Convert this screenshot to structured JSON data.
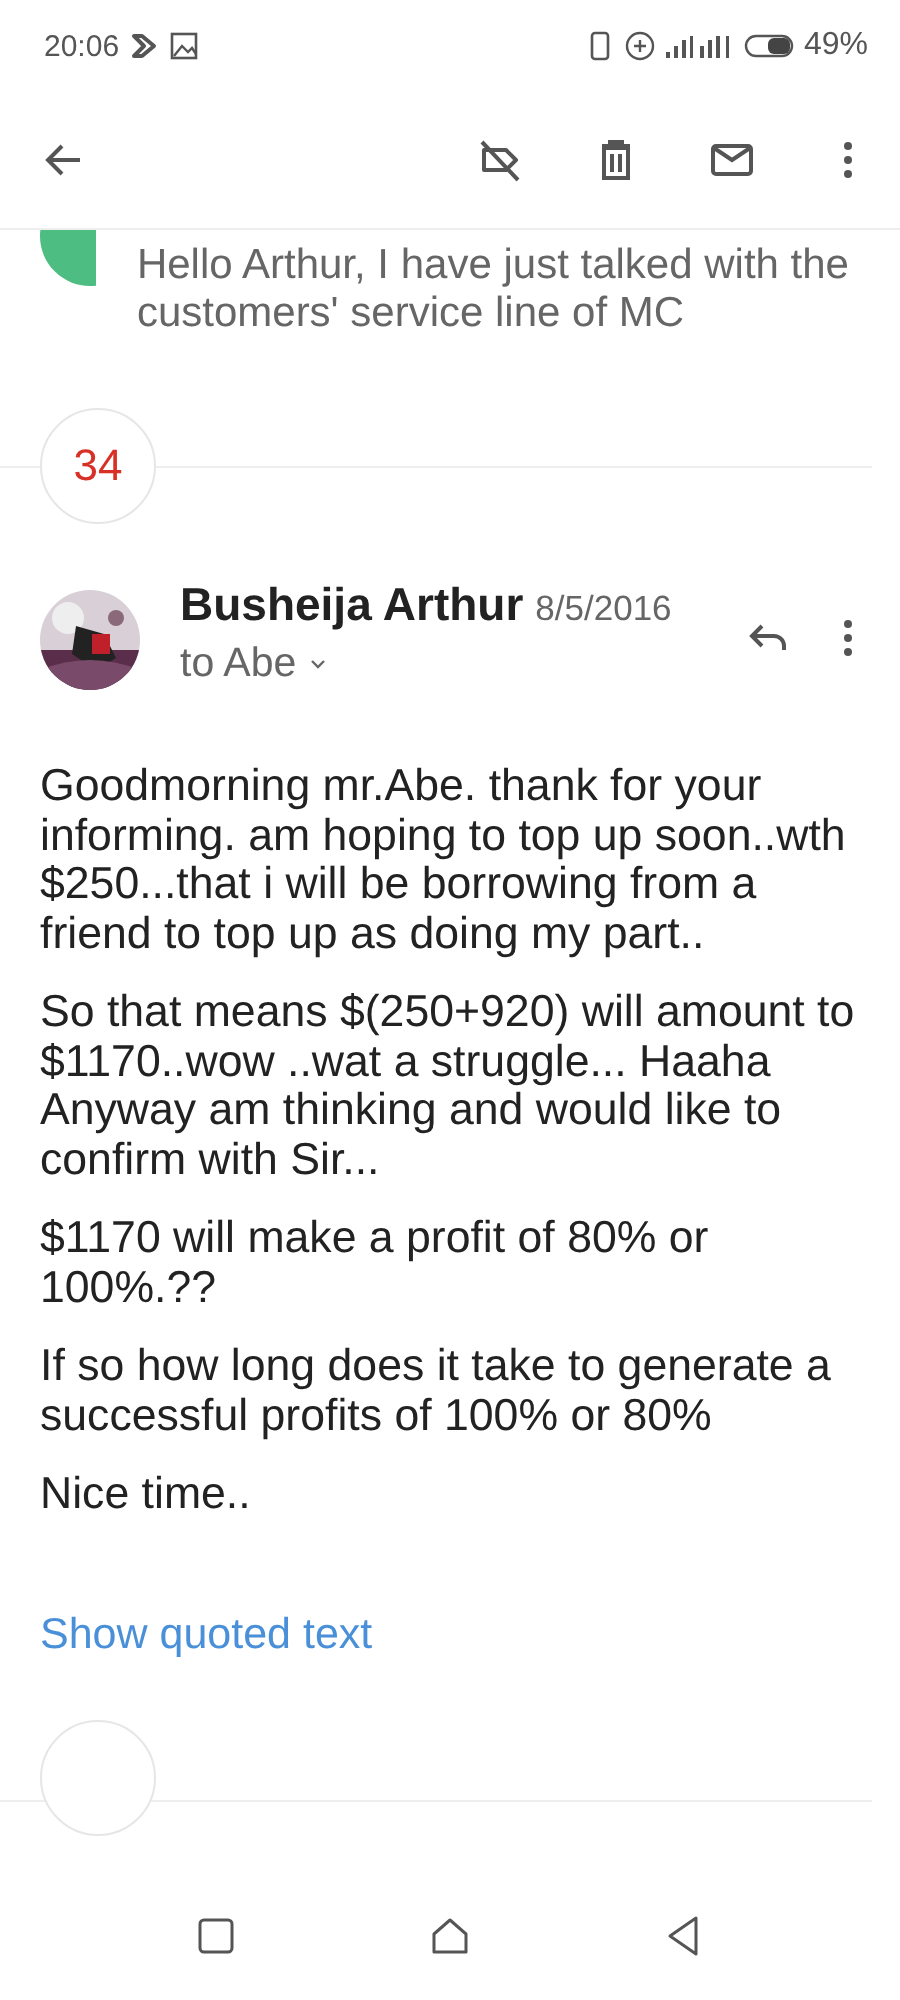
{
  "status_bar": {
    "time": "20:06",
    "battery": "49%"
  },
  "previous_message": {
    "snippet": "Hello Arthur, I have just talked with the customers' service line of MC"
  },
  "collapsed_count": "34",
  "message": {
    "sender": "Busheija Arthur",
    "date": "8/5/2016",
    "recipients": "to Abe",
    "paragraphs": [
      "Goodmorning mr.Abe. thank for your informing. am hoping to top up soon..wth $250...that i will be borrowing from a friend to top up as doing my part..",
      "So that means $(250+920) will amount to $1170..wow ..wat a struggle... Haaha Anyway am thinking and would like to confirm with Sir...",
      "$1170 will make a profit of 80% or 100%.??",
      "If so how long does it take to generate a successful profits of 100% or 80%",
      "Nice time.."
    ],
    "show_quoted": "Show quoted text"
  }
}
